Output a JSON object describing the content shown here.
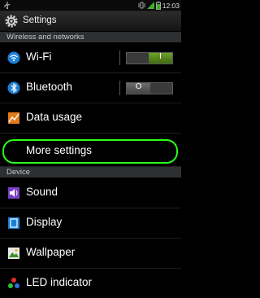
{
  "status_bar": {
    "time": "12:03",
    "icons": [
      "usb-icon",
      "vibrate-icon",
      "signal-icon",
      "battery-icon"
    ]
  },
  "title_bar": {
    "title": "Settings",
    "icon": "settings-icon"
  },
  "sections": [
    {
      "header": "Wireless and networks",
      "items": [
        {
          "label": "Wi-Fi",
          "icon": "wifi-icon",
          "toggle": "on",
          "toggle_text": "I"
        },
        {
          "label": "Bluetooth",
          "icon": "bluetooth-icon",
          "toggle": "off",
          "toggle_text": "O"
        },
        {
          "label": "Data usage",
          "icon": "data-usage-icon"
        },
        {
          "label": "More settings"
        }
      ]
    },
    {
      "header": "Device",
      "items": [
        {
          "label": "Sound",
          "icon": "sound-icon"
        },
        {
          "label": "Display",
          "icon": "display-icon"
        },
        {
          "label": "Wallpaper",
          "icon": "wallpaper-icon"
        },
        {
          "label": "LED indicator",
          "icon": "led-indicator-icon"
        }
      ]
    }
  ],
  "annotation": {
    "highlighted_item": "More settings",
    "highlight_color": "#2bff1a"
  }
}
